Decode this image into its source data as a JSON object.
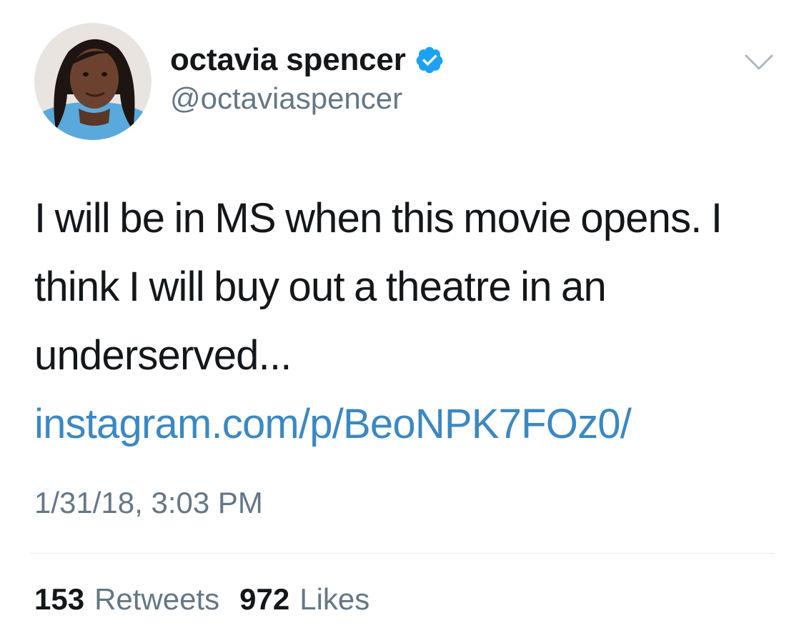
{
  "user": {
    "display_name": "octavia spencer",
    "handle": "@octaviaspencer",
    "verified": true
  },
  "tweet": {
    "text": "I will be in MS when this movie opens. I think I will buy out a theatre in an underserved... ",
    "link_text": "instagram.com/p/BeoNPK7FOz0/",
    "timestamp": "1/31/18, 3:03 PM"
  },
  "stats": {
    "retweets_count": "153",
    "retweets_label": "Retweets",
    "likes_count": "972",
    "likes_label": "Likes"
  },
  "icons": {
    "verified": "verified-badge-icon",
    "menu": "chevron-down-icon"
  },
  "colors": {
    "link": "#3b88c3",
    "secondary_text": "#657786",
    "primary_text": "#14171a",
    "verified_badge": "#1da1f2",
    "divider": "#e1e8ed"
  }
}
